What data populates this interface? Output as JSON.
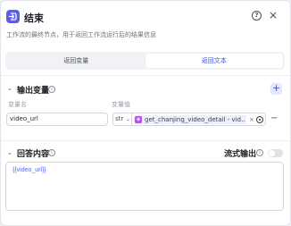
{
  "header": {
    "title": "结束",
    "help_icon": "?",
    "close_icon": "×"
  },
  "description": "工作流的最终节点，用于返回工作流运行后的结果信息",
  "tabs": [
    {
      "label": "返回变量",
      "active": false
    },
    {
      "label": "返回文本",
      "active": true
    }
  ],
  "output_section": {
    "title": "输出变量",
    "add_icon": "+",
    "col_name": "变量名",
    "col_value": "变量值",
    "row": {
      "name": "video_url",
      "type": "str",
      "value_ref": "get_chanjing_video_detail - vid...",
      "clear_icon": "×",
      "remove_icon": "−"
    }
  },
  "answer_section": {
    "title": "回答内容",
    "stream_label": "流式输出",
    "stream_enabled": false,
    "content": "{{video_url}}"
  },
  "colors": {
    "accent": "#3b53e6",
    "node_icon": "#5b5cf0",
    "plugin_icon": "#b84cf0"
  }
}
